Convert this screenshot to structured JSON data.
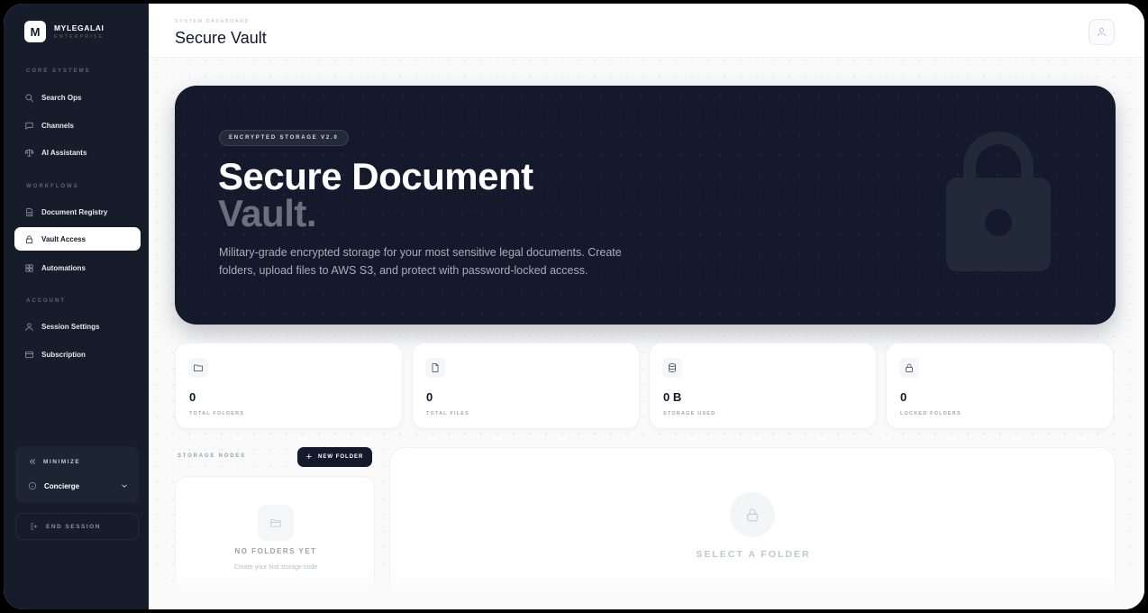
{
  "brand": {
    "name": "MYLEGALAI",
    "subtitle": "ENTERPRISE",
    "logo_letter": "M"
  },
  "sidebar": {
    "sections": [
      {
        "label": "CORE SYSTEMS"
      },
      {
        "label": "WORKFLOWS"
      },
      {
        "label": "ACCOUNT"
      }
    ],
    "items": [
      {
        "label": "Search Ops",
        "icon": "search-icon"
      },
      {
        "label": "Channels",
        "icon": "chat-icon"
      },
      {
        "label": "AI Assistants",
        "icon": "scale-icon"
      },
      {
        "label": "Document Registry",
        "icon": "document-icon"
      },
      {
        "label": "Vault Access",
        "icon": "lock-icon",
        "active": true
      },
      {
        "label": "Automations",
        "icon": "grid-icon"
      },
      {
        "label": "Session Settings",
        "icon": "user-icon"
      },
      {
        "label": "Subscription",
        "icon": "card-icon"
      }
    ],
    "minimize_label": "MINIMIZE",
    "concierge_label": "Concierge",
    "end_session_label": "END SESSION"
  },
  "header": {
    "breadcrumb": "SYSTEM.DASHBOARD",
    "title": "Secure Vault"
  },
  "hero": {
    "badge": "ENCRYPTED STORAGE V2.0",
    "title_line1": "Secure Document",
    "title_line2": "Vault.",
    "description": "Military-grade encrypted storage for your most sensitive legal documents. Create folders, upload files to AWS S3, and protect with password-locked access."
  },
  "stats": [
    {
      "value": "0",
      "label": "TOTAL FOLDERS",
      "icon": "folder-icon"
    },
    {
      "value": "0",
      "label": "TOTAL FILES",
      "icon": "file-icon"
    },
    {
      "value": "0 B",
      "label": "STORAGE USED",
      "icon": "database-icon"
    },
    {
      "value": "0",
      "label": "LOCKED FOLDERS",
      "icon": "lock-icon"
    }
  ],
  "storage": {
    "label": "STORAGE NODES",
    "new_folder_label": "NEW FOLDER",
    "empty_title": "NO FOLDERS YET",
    "empty_subtitle": "Create your first storage node"
  },
  "detail": {
    "placeholder": "SELECT A FOLDER"
  },
  "colors": {
    "sidebar_bg": "#161c2a",
    "hero_bg": "#141a2b",
    "accent_dark": "#111827"
  }
}
